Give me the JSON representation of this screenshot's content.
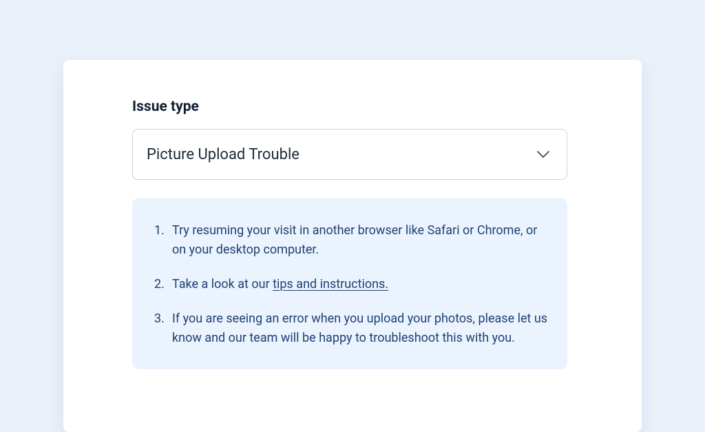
{
  "form": {
    "field_label": "Issue type",
    "select": {
      "value": "Picture Upload Trouble"
    }
  },
  "tips": {
    "items": [
      {
        "text": "Try resuming your visit in another browser like Safari or Chrome, or on your desktop computer."
      },
      {
        "prefix": "Take a look at our ",
        "link": "tips and instructions."
      },
      {
        "text": "If you are seeing an error when you upload your photos, please let us know and our team will be happy to troubleshoot this with you."
      }
    ]
  }
}
